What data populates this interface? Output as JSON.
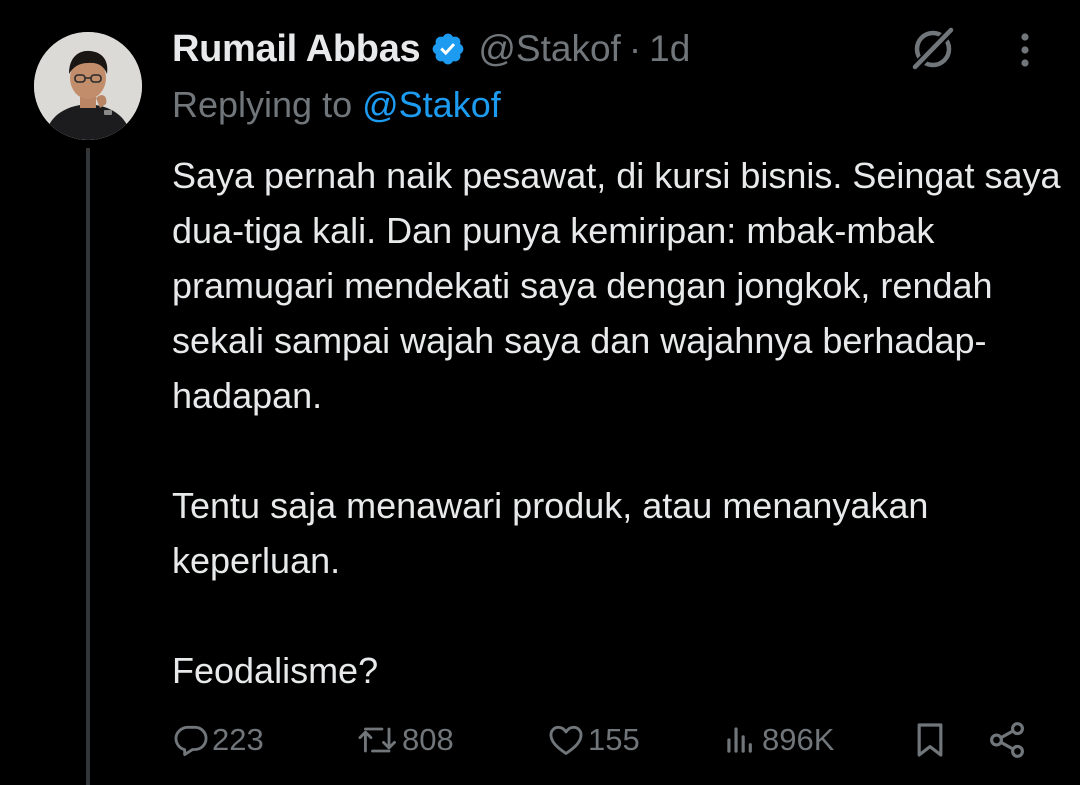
{
  "tweet": {
    "author_name": "Rumail Abbas",
    "handle": "@Stakof",
    "separator": "·",
    "time": "1d",
    "replying_prefix": "Replying to",
    "replying_to": "@Stakof",
    "paragraphs": [
      "Saya pernah naik pesawat, di kursi bisnis. Seingat saya dua-tiga kali. Dan punya kemiripan: mbak-mbak pramugari mendekati saya dengan jongkok, rendah sekali sampai wajah saya dan wajahnya berhadap-hadapan.",
      "Tentu saja menawari produk, atau menanyakan keperluan.",
      "Feodalisme?"
    ]
  },
  "actions": {
    "replies": "223",
    "reposts": "808",
    "likes": "155",
    "views": "896K"
  },
  "icons": {
    "verified": "verified-badge-icon",
    "grok": "grok-icon",
    "more": "more-icon",
    "reply": "reply-icon",
    "repost": "repost-icon",
    "like": "like-icon",
    "views": "views-icon",
    "bookmark": "bookmark-icon",
    "share": "share-icon"
  },
  "colors": {
    "background": "#000000",
    "text": "#e7e9ea",
    "muted": "#71767b",
    "accent": "#1d9bf0",
    "thread_line": "#333639"
  }
}
